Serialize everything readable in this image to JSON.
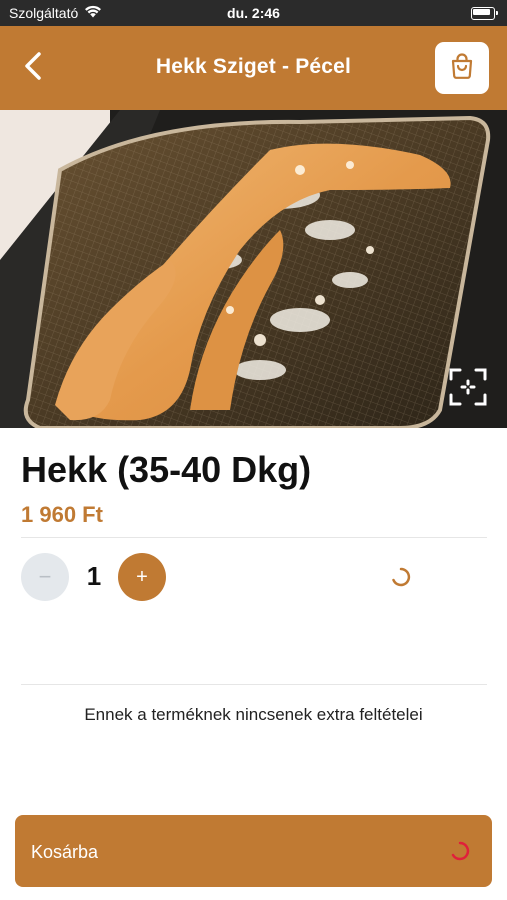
{
  "status_bar": {
    "carrier": "Szolgáltató",
    "time": "du. 2:46",
    "icons": [
      "wifi-icon",
      "battery-icon"
    ]
  },
  "header": {
    "title": "Hekk Sziget - Pécel",
    "back_icon": "chevron-left-icon",
    "cart_icon": "shopping-bag-icon"
  },
  "hero": {
    "image": "fried-fish-in-fryer-basket",
    "expand_icon": "expand-scan-icon"
  },
  "product": {
    "name": "Hekk (35-40 Dkg)",
    "price": "1 960 Ft"
  },
  "quantity": {
    "value": "1",
    "minus_label": "−",
    "plus_label": "+"
  },
  "extras_note": "Ennek a terméknek nincsenek extra feltételei",
  "add_to_cart": {
    "label": "Kosárba"
  },
  "colors": {
    "brand": "#c07a33",
    "status_bar_bg": "#2b2b2b",
    "minus_bg": "#e4e8ec",
    "spinner_red": "#e0203a"
  }
}
